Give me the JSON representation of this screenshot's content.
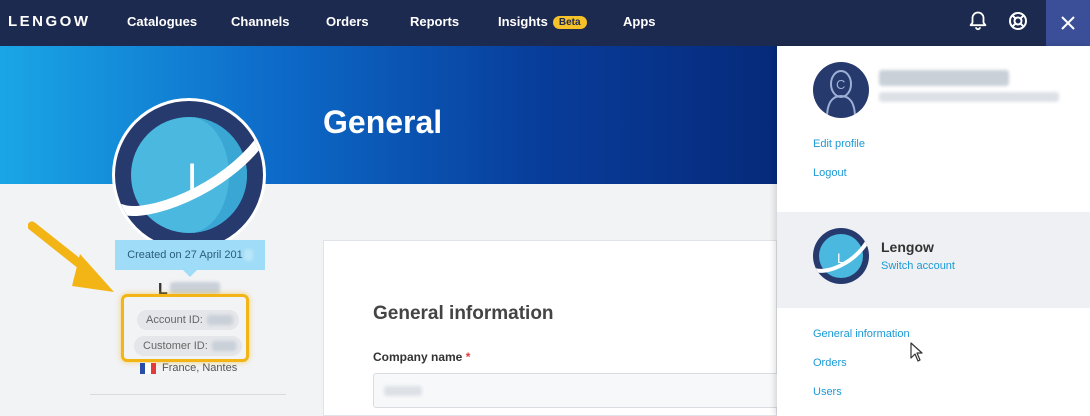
{
  "nav": {
    "logo": "LENGOW",
    "items": [
      {
        "label": "Catalogues"
      },
      {
        "label": "Channels"
      },
      {
        "label": "Orders"
      },
      {
        "label": "Reports"
      },
      {
        "label": "Insights",
        "badge": "Beta"
      },
      {
        "label": "Apps"
      }
    ],
    "icons": [
      "bell-icon",
      "help-lifebuoy-icon",
      "close-icon"
    ]
  },
  "hero": {
    "title": "General"
  },
  "account": {
    "avatar_letter": "L",
    "created_text": "Created on 27 April 201",
    "name_initial": "L",
    "account_id_label": "Account ID:",
    "customer_id_label": "Customer ID:",
    "location": "France, Nantes"
  },
  "card": {
    "title": "General information",
    "company_name_label": "Company name",
    "required_mark": "*"
  },
  "panel": {
    "user_avatar_letter": "C",
    "edit_profile": "Edit profile",
    "logout": "Logout",
    "account_avatar_letter": "L",
    "account_name": "Lengow",
    "switch_account": "Switch account",
    "links": [
      "General information",
      "Orders",
      "Users"
    ]
  },
  "colors": {
    "nav_bg": "#1d2a4f",
    "accent_link": "#1a9ad6",
    "beta_badge": "#f5c22a",
    "highlight": "#f3b416"
  }
}
